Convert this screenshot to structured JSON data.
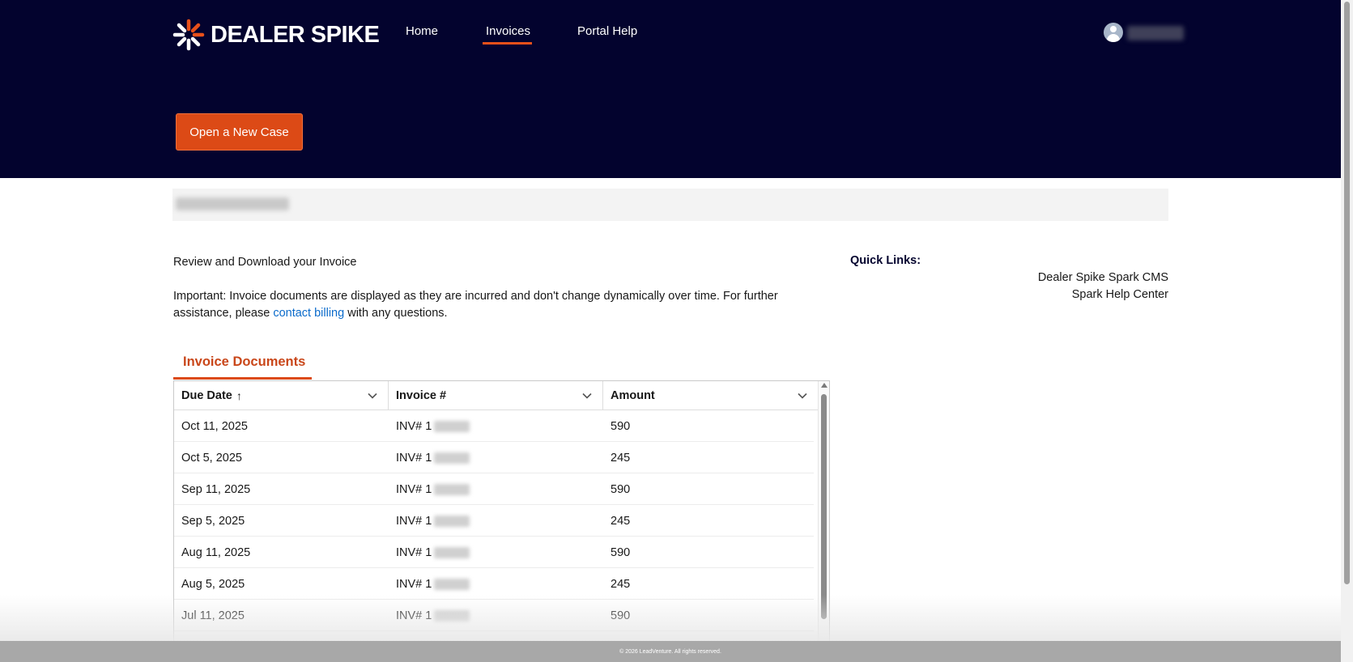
{
  "brand": {
    "name": "DEALER SPIKE",
    "accent": "#e8501a",
    "hero_bg": "#03032e"
  },
  "nav": {
    "home": "Home",
    "invoices": "Invoices",
    "portal_help": "Portal Help",
    "active": "Invoices"
  },
  "hero": {
    "new_case_label": "Open a New Case"
  },
  "content": {
    "intro": "Review and Download your Invoice",
    "important_before": "Important: Invoice documents are displayed as they are incurred and don't change dynamically over time. For further assistance, please ",
    "contact_link": "contact billing",
    "important_after": " with any questions."
  },
  "quick_links": {
    "title": "Quick Links:",
    "items": [
      "Dealer Spike Spark CMS",
      "Spark Help Center"
    ]
  },
  "invoices": {
    "tab_label": "Invoice Documents",
    "columns": [
      "Due Date",
      "Invoice #",
      "Amount"
    ],
    "sort_indicator": "↑",
    "rows": [
      {
        "due_date": "Oct 11, 2025",
        "invoice_prefix": "INV# 1",
        "amount": "590"
      },
      {
        "due_date": "Oct 5, 2025",
        "invoice_prefix": "INV# 1",
        "amount": "245"
      },
      {
        "due_date": "Sep 11, 2025",
        "invoice_prefix": "INV# 1",
        "amount": "590"
      },
      {
        "due_date": "Sep 5, 2025",
        "invoice_prefix": "INV# 1",
        "amount": "245"
      },
      {
        "due_date": "Aug 11, 2025",
        "invoice_prefix": "INV# 1",
        "amount": "590"
      },
      {
        "due_date": "Aug 5, 2025",
        "invoice_prefix": "INV# 1",
        "amount": "245"
      },
      {
        "due_date": "Jul 11, 2025",
        "invoice_prefix": "INV# 1",
        "amount": "590"
      }
    ]
  },
  "footer": {
    "text": "© 2026 LeadVenture. All rights reserved."
  }
}
